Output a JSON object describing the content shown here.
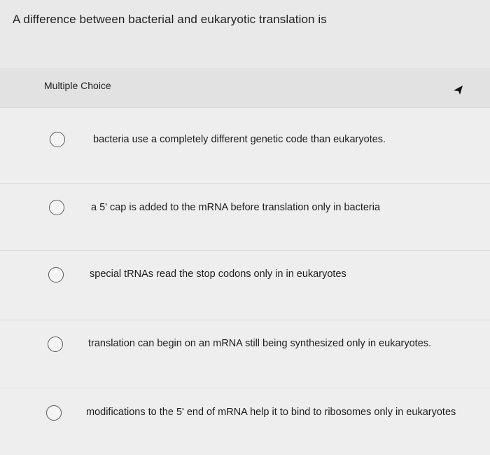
{
  "question": {
    "text": "A difference between bacterial and eukaryotic translation is"
  },
  "card": {
    "type_label": "Multiple Choice",
    "options": [
      {
        "label": "bacteria use a completely different genetic code than eukaryotes."
      },
      {
        "label": "a 5' cap is added to the mRNA before translation only in bacteria"
      },
      {
        "label": "special tRNAs read the stop codons only in in eukaryotes"
      },
      {
        "label": "translation can begin on an mRNA still being synthesized only in eukaryotes."
      },
      {
        "label": "modifications to the 5' end of mRNA help it to bind to ribosomes only in eukaryotes"
      }
    ]
  }
}
